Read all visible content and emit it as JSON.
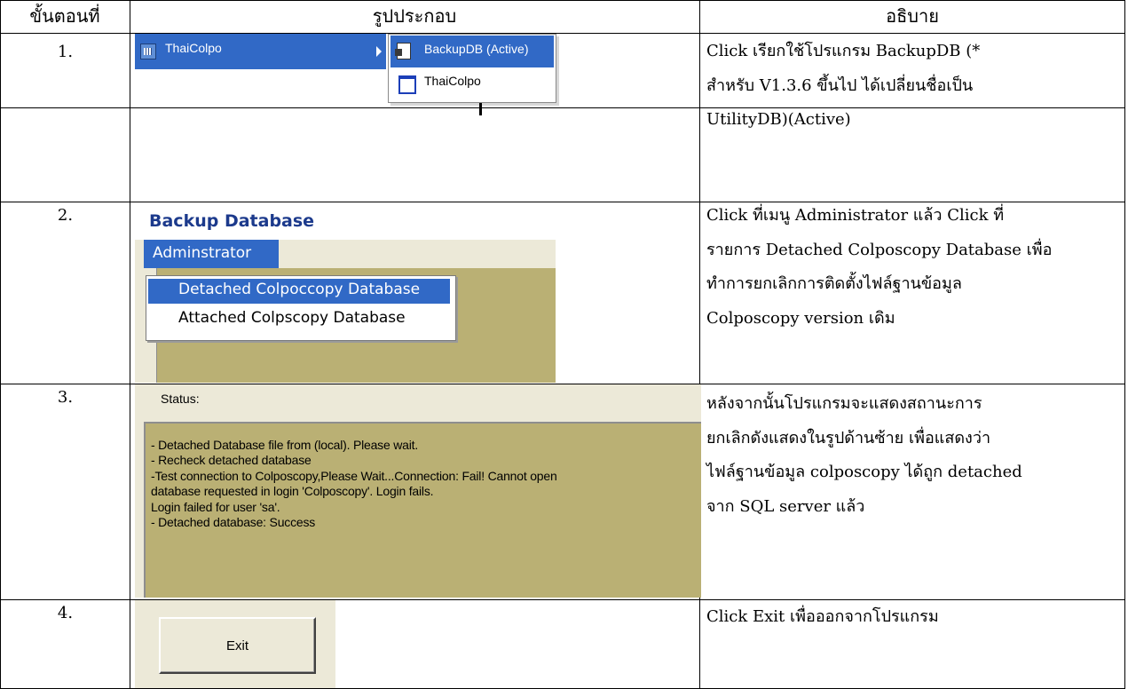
{
  "header": {
    "step": "ขั้นตอนที่",
    "picture": "รูปประกอบ",
    "description": "อธิบาย"
  },
  "rows": [
    {
      "number": "1.",
      "description_lines": [
        "Click เรียกใช้โปรแกรม BackupDB (*",
        "สำหรับ V1.3.6 ขึ้นไป ได้เปลี่ยนชื่อเป็น",
        "UtilityDB)(Active)"
      ],
      "screen": {
        "menu_item": "ThaiColpo",
        "submenu_items": [
          "BackupDB (Active)",
          "ThaiColpo"
        ]
      }
    },
    {
      "number": "2.",
      "description_lines": [
        "Click ที่เมนู Administrator แล้ว Click ที่",
        "รายการ Detached Colposcopy Database เพื่อ",
        "ทำการยกเลิกการติดตั้งไฟล์ฐานข้อมูล",
        "Colposcopy version เดิม"
      ],
      "screen": {
        "window_title": "Backup Database",
        "menu": "Adminstrator",
        "dropdown_items": [
          "Detached Colpoccopy Database",
          "Attached Colpscopy Database"
        ]
      }
    },
    {
      "number": "3.",
      "description_lines": [
        "หลังจากนั้นโปรแกรมจะแสดงสถานะการ",
        "ยกเลิกดังแสดงในรูปด้านซ้าย เพื่อแสดงว่า",
        "ไฟล์ฐานข้อมูล colposcopy ได้ถูก detached",
        "จาก SQL server แล้ว"
      ],
      "screen": {
        "status_label": "Status:",
        "status_lines": [
          "- Detached Database file from (local). Please wait.",
          " - Recheck detached database",
          "  -Test connection to Colposcopy,Please Wait...Connection: Fail!  Cannot open",
          "database requested in login 'Colposcopy'. Login fails.",
          "Login failed for user 'sa'.",
          " - Detached database: Success"
        ]
      }
    },
    {
      "number": "4.",
      "description_lines": [
        "Click Exit เพื่อออกจากโปรแกรม"
      ],
      "screen": {
        "button": "Exit"
      }
    }
  ],
  "colors": {
    "selection_blue": "#3169c6",
    "window_face": "#ece9d8",
    "status_olive": "#bab074"
  }
}
